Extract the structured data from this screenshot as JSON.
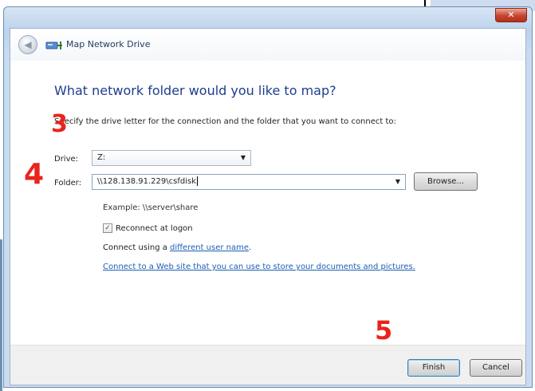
{
  "dialog": {
    "title": "Map Network Drive",
    "close_label": "✕"
  },
  "main": {
    "heading": "What network folder would you like to map?",
    "instruction": "Specify the drive letter for the connection and the folder that you want to connect to:",
    "drive_label": "Drive:",
    "drive_value": "Z:",
    "folder_label": "Folder:",
    "folder_value": "\\\\128.138.91.229\\csfdisk",
    "browse_label": "Browse...",
    "example_text": "Example: \\\\server\\share",
    "reconnect_label": "Reconnect at logon",
    "reconnect_checked": true,
    "connect_prefix": "Connect using a ",
    "connect_link": "different user name",
    "connect_suffix": ".",
    "web_link": "Connect to a Web site that you can use to store your documents and pictures."
  },
  "footer": {
    "finish_label": "Finish",
    "cancel_label": "Cancel"
  },
  "annotations": {
    "step_3": "3",
    "step_4": "4",
    "step_5": "5"
  },
  "icons": {
    "back": "back-arrow-icon",
    "drive": "network-drive-icon",
    "dropdown": "chevron-down-icon",
    "checkbox": "checkmark-icon"
  },
  "colors": {
    "heading": "#1e3d8f",
    "link": "#1a5fb4",
    "annotation": "#e8241c",
    "close_button": "#c7432e"
  }
}
